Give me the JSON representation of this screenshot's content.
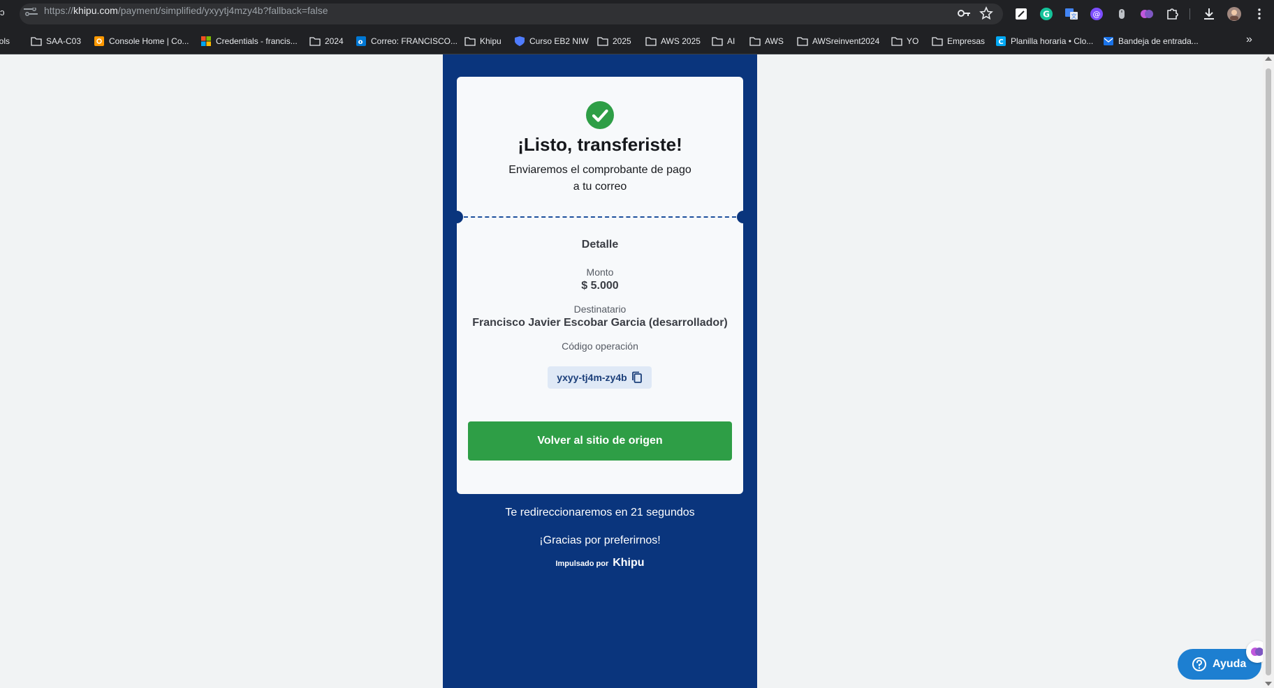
{
  "browser": {
    "url_prefix": "https://",
    "url_host": "khipu.com",
    "url_path": "/payment/simplified/yxyytj4mzy4b?fallback=false",
    "left_edge_glyph": "Tools"
  },
  "bookmarks": [
    {
      "label": "SAA-C03",
      "icon": "folder-icon"
    },
    {
      "label": "Console Home | Co...",
      "icon": "aws-console-icon"
    },
    {
      "label": "Credentials - francis...",
      "icon": "microsoft-icon"
    },
    {
      "label": "2024",
      "icon": "folder-icon"
    },
    {
      "label": "Correo: FRANCISCO...",
      "icon": "outlook-icon"
    },
    {
      "label": "Khipu",
      "icon": "folder-icon"
    },
    {
      "label": "Curso EB2 NIW",
      "icon": "shield-icon"
    },
    {
      "label": "2025",
      "icon": "folder-icon"
    },
    {
      "label": "AWS 2025",
      "icon": "folder-icon"
    },
    {
      "label": "AI",
      "icon": "folder-icon"
    },
    {
      "label": "AWS",
      "icon": "folder-icon"
    },
    {
      "label": "AWSreinvent2024",
      "icon": "folder-icon"
    },
    {
      "label": "YO",
      "icon": "folder-icon"
    },
    {
      "label": "Empresas",
      "icon": "folder-icon"
    },
    {
      "label": "Planilla horaria • Clo...",
      "icon": "clockify-icon"
    },
    {
      "label": "Bandeja de entrada...",
      "icon": "mail-icon"
    }
  ],
  "bookmarks_more": "»",
  "card": {
    "title": "¡Listo, transferiste!",
    "subtitle_line1": "Enviaremos el comprobante de pago",
    "subtitle_line2": "a tu correo",
    "detail_heading": "Detalle",
    "amount_label": "Monto",
    "amount_value": "$ 5.000",
    "recipient_label": "Destinatario",
    "recipient_value": "Francisco Javier Escobar Garcia (desarrollador)",
    "operation_label": "Código operación",
    "operation_code": "yxyy-tj4m-zy4b",
    "back_button": "Volver al sitio de origen"
  },
  "footer": {
    "redirect_text": "Te redireccionaremos en 21 segundos",
    "thanks_text": "¡Gracias por preferirnos!",
    "powered_label": "Impulsado por",
    "powered_brand": "Khipu"
  },
  "help": {
    "label": "Ayuda"
  },
  "colors": {
    "panel_bg": "#0a357d",
    "accent_green": "#2e9e46",
    "help_blue": "#1d7fd1"
  }
}
